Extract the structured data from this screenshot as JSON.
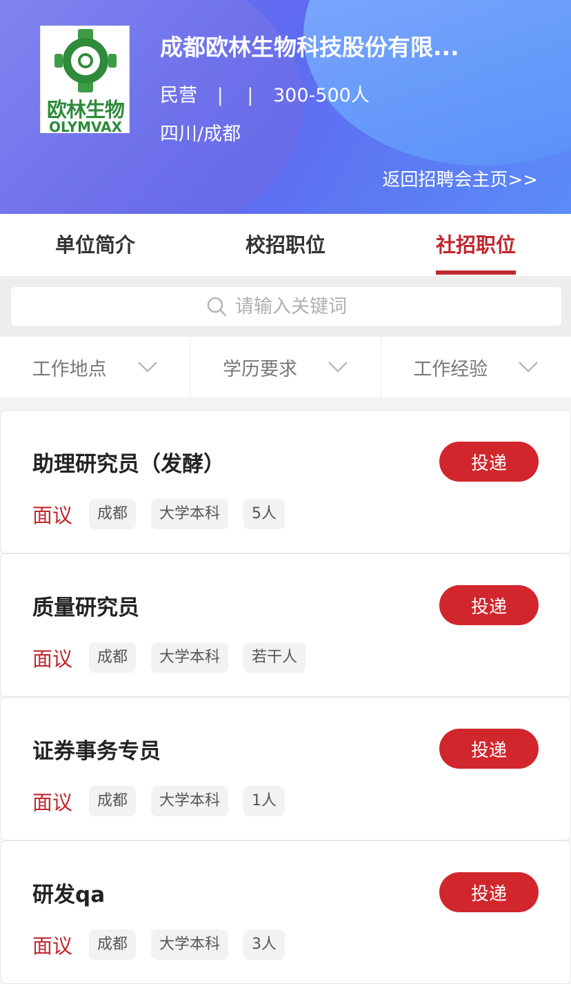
{
  "company": {
    "name": "成都欧林生物科技股份有限...",
    "ownership": "民营",
    "separator": "|",
    "size": "300-500人",
    "location": "四川/成都",
    "back_link": "返回招聘会主页>>",
    "logo": {
      "cn": "欧林生物",
      "en": "OLYMVAX",
      "color": "#2d8a3b"
    }
  },
  "tabs": [
    {
      "label": "单位简介",
      "active": false
    },
    {
      "label": "校招职位",
      "active": false
    },
    {
      "label": "社招职位",
      "active": true
    }
  ],
  "search": {
    "placeholder": "请输入关键词"
  },
  "filters": [
    {
      "label": "工作地点"
    },
    {
      "label": "学历要求"
    },
    {
      "label": "工作经验"
    }
  ],
  "jobs": [
    {
      "title": "助理研究员（发酵）",
      "salary": "面议",
      "city": "成都",
      "education": "大学本科",
      "headcount": "5人",
      "button": "投递"
    },
    {
      "title": "质量研究员",
      "salary": "面议",
      "city": "成都",
      "education": "大学本科",
      "headcount": "若干人",
      "button": "投递"
    },
    {
      "title": "证券事务专员",
      "salary": "面议",
      "city": "成都",
      "education": "大学本科",
      "headcount": "1人",
      "button": "投递"
    },
    {
      "title": "研发qa",
      "salary": "面议",
      "city": "成都",
      "education": "大学本科",
      "headcount": "3人",
      "button": "投递"
    }
  ],
  "colors": {
    "accent": "#c0272d",
    "button": "#d0262c",
    "header": "#6b72ee"
  }
}
